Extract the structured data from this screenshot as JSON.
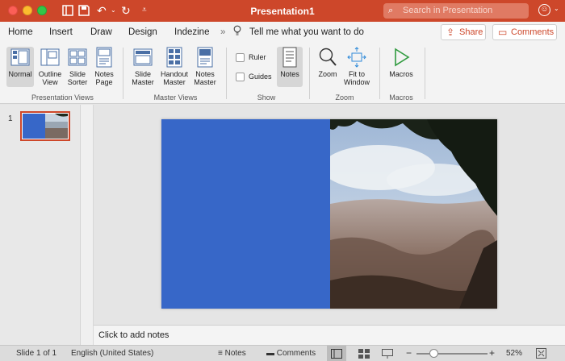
{
  "window": {
    "title": "Presentation1"
  },
  "quickaccess": {
    "undo_label": "↶",
    "redo_label": "↻"
  },
  "search": {
    "placeholder": "Search in Presentation"
  },
  "tabs": [
    "Home",
    "Insert",
    "Draw",
    "Design",
    "Indezine"
  ],
  "tellme": "Tell me what you want to do",
  "share_label": "Share",
  "comments_label": "Comments",
  "ribbon": {
    "presentation_views": {
      "group_label": "Presentation Views",
      "buttons": [
        {
          "l1": "Normal",
          "l2": ""
        },
        {
          "l1": "Outline",
          "l2": "View"
        },
        {
          "l1": "Slide",
          "l2": "Sorter"
        },
        {
          "l1": "Notes",
          "l2": "Page"
        }
      ]
    },
    "master_views": {
      "group_label": "Master Views",
      "buttons": [
        {
          "l1": "Slide",
          "l2": "Master"
        },
        {
          "l1": "Handout",
          "l2": "Master"
        },
        {
          "l1": "Notes",
          "l2": "Master"
        }
      ]
    },
    "show": {
      "group_label": "Show",
      "ruler": "Ruler",
      "guides": "Guides",
      "notes": "Notes"
    },
    "zoom": {
      "group_label": "Zoom",
      "zoom": "Zoom",
      "fit_l1": "Fit to",
      "fit_l2": "Window"
    },
    "macros": {
      "group_label": "Macros",
      "macros": "Macros"
    }
  },
  "slides": [
    {
      "number": "1"
    }
  ],
  "notes_placeholder": "Click to add notes",
  "status": {
    "slide_of": "Slide 1 of 1",
    "language": "English (United States)",
    "notes": "Notes",
    "comments": "Comments",
    "zoom": "52%"
  },
  "colors": {
    "accent": "#cd472a",
    "slide_blue": "#3767c8"
  }
}
